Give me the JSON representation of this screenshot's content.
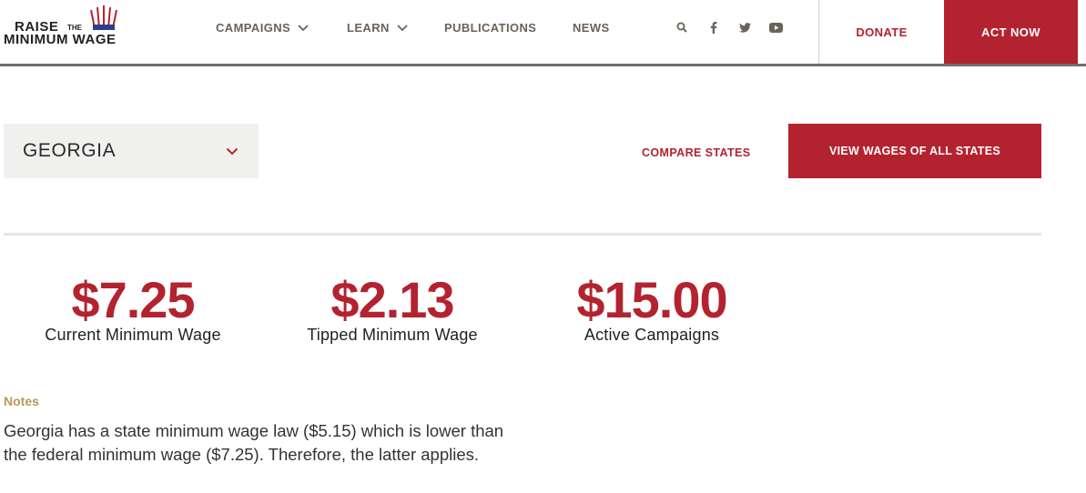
{
  "header": {
    "logo": {
      "line1": "RAISE",
      "the": "THE",
      "line2": "MINIMUM WAGE"
    },
    "nav": [
      {
        "label": "CAMPAIGNS",
        "has_dropdown": true
      },
      {
        "label": "LEARN",
        "has_dropdown": true
      },
      {
        "label": "PUBLICATIONS",
        "has_dropdown": false
      },
      {
        "label": "NEWS",
        "has_dropdown": false
      }
    ],
    "social_icons": [
      "search-icon",
      "facebook-icon",
      "twitter-icon",
      "youtube-icon"
    ],
    "donate_label": "DONATE",
    "act_now_label": "ACT NOW"
  },
  "state_bar": {
    "selected_state": "GEORGIA",
    "compare_label": "COMPARE STATES",
    "view_all_label": "VIEW WAGES OF ALL STATES"
  },
  "stats": {
    "current": {
      "value": "$7.25",
      "label": "Current Minimum Wage"
    },
    "tipped": {
      "value": "$2.13",
      "label": "Tipped Minimum Wage"
    },
    "active": {
      "value": "$15.00",
      "label": "Active Campaigns"
    }
  },
  "notes": {
    "title": "Notes",
    "body": "Georgia has a state minimum wage law ($5.15) which is lower than the federal minimum wage ($7.25). Therefore, the latter applies."
  },
  "colors": {
    "brand_red": "#b3232f",
    "nav_text": "#6b6259",
    "notes_gold": "#b39a5a"
  }
}
